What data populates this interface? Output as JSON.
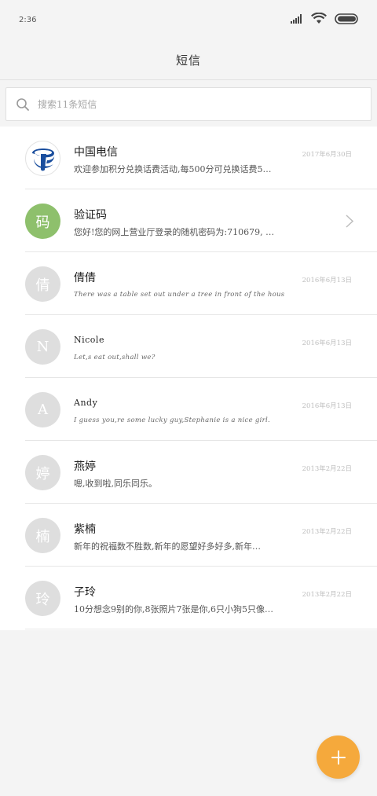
{
  "status": {
    "time": "2:36"
  },
  "header": {
    "title": "短信"
  },
  "search": {
    "placeholder": "搜索11条短信"
  },
  "messages": [
    {
      "avatar": "",
      "name": "中国电信",
      "preview": "欢迎参加积分兑换话费活动,每500分可兑换话费5…",
      "date": "2017年6月30日",
      "icon": "china-telecom-logo"
    },
    {
      "avatar": "码",
      "name": "验证码",
      "preview": "您好!您的网上营业厅登录的随机密码为:710679, …",
      "date": "",
      "icon": "chevron-right-icon"
    },
    {
      "avatar": "倩",
      "name": "倩倩",
      "preview": "There was a table set out under a tree in front of the hous",
      "date": "2016年6月13日"
    },
    {
      "avatar": "N",
      "name": "Nicole",
      "preview": "Let,s eat out,shall we?",
      "date": "2016年6月13日"
    },
    {
      "avatar": "A",
      "name": "Andy",
      "preview": "I guess you,re some lucky guy,Stephanie is a nice girl.",
      "date": "2016年6月13日"
    },
    {
      "avatar": "婷",
      "name": "燕婷",
      "preview": "嗯,收到啦,同乐同乐。",
      "date": "2013年2月22日"
    },
    {
      "avatar": "楠",
      "name": "紫楠",
      "preview": "新年的祝福数不胜数,新年的愿望好多好多,新年…",
      "date": "2013年2月22日"
    },
    {
      "avatar": "玲",
      "name": "子玲",
      "preview": "10分想念9别的你,8张照片7张是你,6只小狗5只像…",
      "date": "2013年2月22日"
    }
  ],
  "fab": {
    "icon": "plus-icon"
  },
  "colors": {
    "accent": "#f5a93c",
    "avatar_green": "#8ec06c",
    "avatar_gray": "#dedede"
  }
}
